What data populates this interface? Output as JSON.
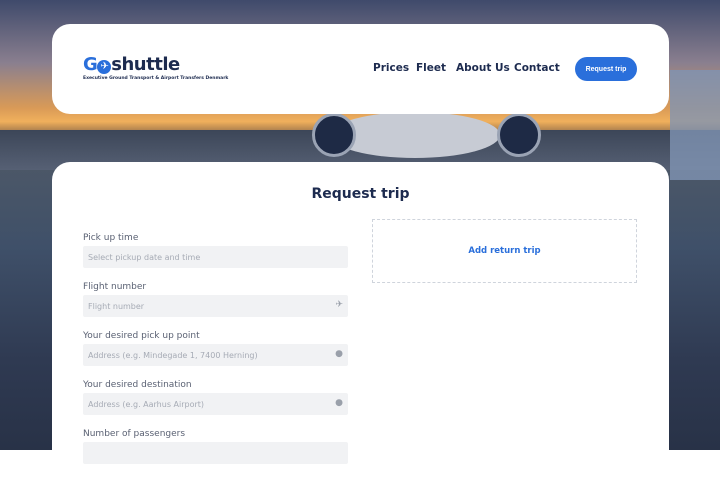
{
  "brand": {
    "name_go": "GO",
    "name_shuttle": "shuttle",
    "tagline": "Executive Ground Transport & Airport Transfers Denmark"
  },
  "nav": {
    "items": [
      "Prices",
      "Fleet",
      "About Us",
      "Contact"
    ],
    "cta": "Request trip"
  },
  "form": {
    "title": "Request trip",
    "return_trip": "Add return trip",
    "fields": [
      {
        "label": "Pick up time",
        "placeholder": "Select pickup date and time",
        "icon": ""
      },
      {
        "label": "Flight number",
        "placeholder": "Flight number",
        "icon": "plane-icon"
      },
      {
        "label": "Your desired pick up point",
        "placeholder": "Address (e.g. Mindegade 1, 7400 Herning)",
        "icon": "location-pin-icon"
      },
      {
        "label": "Your desired destination",
        "placeholder": "Address (e.g. Aarhus Airport)",
        "icon": "location-pin-icon"
      },
      {
        "label": "Number of passengers",
        "placeholder": "",
        "icon": ""
      }
    ]
  },
  "colors": {
    "accent": "#2a6fdb",
    "text": "#1d2b4f"
  }
}
